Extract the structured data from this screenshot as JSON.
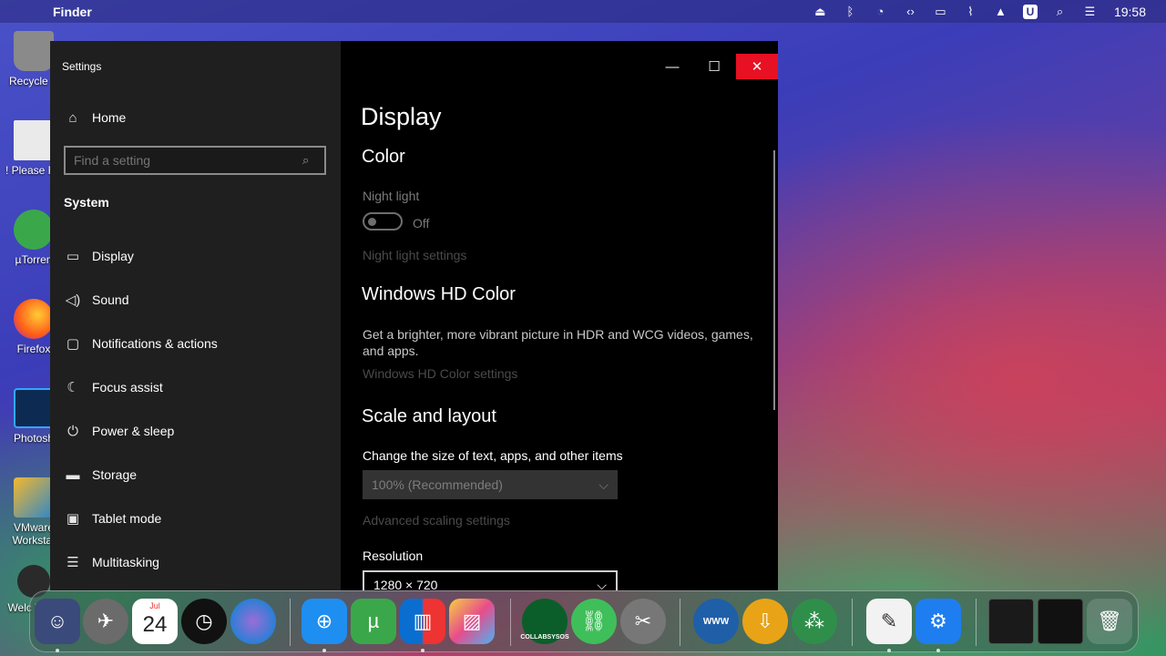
{
  "menubar": {
    "apple_glyph": "",
    "app_name": "Finder",
    "tray_icons": [
      "eject-icon",
      "bluetooth-icon",
      "timer-icon",
      "code-icon",
      "display-icon",
      "wifi-off-icon",
      "eject-icon",
      "u-icon",
      "search-icon",
      "control-center-icon"
    ],
    "u_label": "U",
    "clock": "19:58"
  },
  "desktop": {
    "icons": [
      {
        "label": "Recycle B",
        "color": "#8a8a8a"
      },
      {
        "label": "! Please Re",
        "color": "#e8e8e8"
      },
      {
        "label": "µTorren",
        "color": "#3aa84a"
      },
      {
        "label": "Firefox",
        "color": "#ff7a1a"
      },
      {
        "label": "Photosh",
        "color": "#1a5aa8"
      },
      {
        "label": "VMware Workstat",
        "color": "#2e86c9"
      },
      {
        "label": "Welc Wind",
        "color": "#3b3b3b"
      }
    ]
  },
  "window": {
    "title": "Settings",
    "controls": {
      "minimize": "—",
      "maximize": "☐",
      "close": "✕"
    }
  },
  "sidebar": {
    "home": "Home",
    "search_placeholder": "Find a setting",
    "section": "System",
    "items": [
      {
        "label": "Display",
        "icon": "monitor-icon"
      },
      {
        "label": "Sound",
        "icon": "speaker-icon"
      },
      {
        "label": "Notifications & actions",
        "icon": "notification-icon"
      },
      {
        "label": "Focus assist",
        "icon": "moon-icon"
      },
      {
        "label": "Power & sleep",
        "icon": "power-icon"
      },
      {
        "label": "Storage",
        "icon": "storage-icon"
      },
      {
        "label": "Tablet mode",
        "icon": "tablet-icon"
      },
      {
        "label": "Multitasking",
        "icon": "multitasking-icon"
      }
    ]
  },
  "main": {
    "title": "Display",
    "color": {
      "heading": "Color",
      "night_light_label": "Night light",
      "night_light_state": "Off",
      "night_light_settings": "Night light settings"
    },
    "hdr": {
      "heading": "Windows HD Color",
      "description": "Get a brighter, more vibrant picture in HDR and WCG videos, games, and apps.",
      "settings_link": "Windows HD Color settings"
    },
    "scale": {
      "heading": "Scale and layout",
      "size_label": "Change the size of text, apps, and other items",
      "size_value": "100% (Recommended)",
      "advanced_link": "Advanced scaling settings",
      "resolution_label": "Resolution",
      "resolution_value": "1280 × 720"
    }
  },
  "dock": {
    "calendar_month": "Jul",
    "calendar_day": "24",
    "collabsysos_label": "COLLABSYSOS",
    "www_label": "WWW"
  }
}
